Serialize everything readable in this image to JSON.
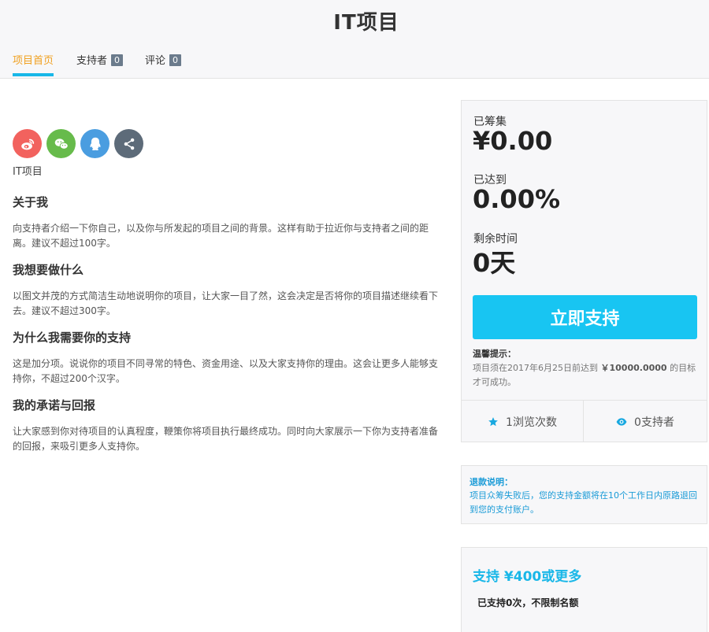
{
  "header": {
    "title": "IT项目"
  },
  "tabs": [
    {
      "label": "项目首页",
      "count": null
    },
    {
      "label": "支持者",
      "count": "0"
    },
    {
      "label": "评论",
      "count": "0"
    }
  ],
  "share_icons": [
    "weibo-icon",
    "wechat-icon",
    "qq-icon",
    "share-icon"
  ],
  "project_name": "IT项目",
  "sections": [
    {
      "title": "关于我",
      "body": "向支持者介绍一下你自己，以及你与所发起的项目之间的背景。这样有助于拉近你与支持者之间的距离。建议不超过100字。"
    },
    {
      "title": "我想要做什么",
      "body": "以图文并茂的方式简洁生动地说明你的项目，让大家一目了然，这会决定是否将你的项目描述继续看下去。建议不超过300字。"
    },
    {
      "title": "为什么我需要你的支持",
      "body": "这是加分项。说说你的项目不同寻常的特色、资金用途、以及大家支持你的理由。这会让更多人能够支持你，不超过200个汉字。"
    },
    {
      "title": "我的承诺与回报",
      "body": "让大家感到你对待项目的认真程度，鞭策你将项目执行最终成功。同时向大家展示一下你为支持者准备的回报，来吸引更多人支持你。"
    }
  ],
  "funding": {
    "raised_label": "已筹集",
    "raised_value": "¥0.00",
    "reached_label": "已达到",
    "reached_value": "0.00%",
    "remaining_label": "剩余时间",
    "remaining_value": "0天",
    "support_button": "立即支持",
    "tip_title": "温馨提示：",
    "tip_prefix": "项目须在2017年6月25日前达到",
    "tip_amount": "￥10000.0000",
    "tip_suffix": "的目标才可成功。",
    "views_text": "1浏览次数",
    "supporters_text": "0支持者"
  },
  "refund": {
    "title": "退款说明：",
    "text": "项目众筹失败后，您的支持金额将在10个工作日内原路退回到您的支付账户。"
  },
  "tier": {
    "title": "支持 ¥400或更多",
    "subtitle": "已支持0次，不限制名额"
  },
  "colors": {
    "accent": "#18c5f2",
    "tab_active": "#f0a020",
    "weibo": "#f2625e",
    "wechat": "#67bb4b",
    "qq": "#4a9de0",
    "share": "#5d6b79"
  }
}
